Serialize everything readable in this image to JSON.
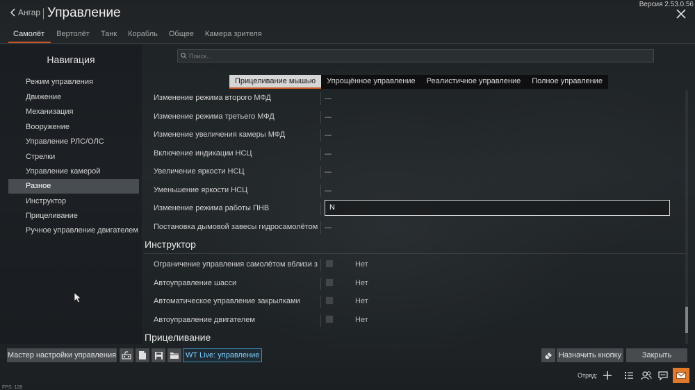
{
  "header": {
    "back_label": "Ангар",
    "title": "Управление",
    "version": "Версия 2.53.0.56"
  },
  "vehicle_tabs": [
    "Самолёт",
    "Вертолёт",
    "Танк",
    "Корабль",
    "Общее",
    "Камера зрителя"
  ],
  "nav": {
    "title": "Навигация",
    "items": [
      "Режим управления",
      "Движение",
      "Механизация",
      "Вооружение",
      "Управление РЛС/ОЛС",
      "Стрелки",
      "Управление камерой",
      "Разное",
      "Инструктор",
      "Прицеливание",
      "Ручное управление двигателем"
    ],
    "active_index": 7
  },
  "search": {
    "placeholder": "Поиск..."
  },
  "mode_tabs": [
    "Прицеливание мышью",
    "Упрощённое управление",
    "Реалистичное управление",
    "Полное управление"
  ],
  "bindings": [
    {
      "label": "Изменение режима второго МФД",
      "value": "---"
    },
    {
      "label": "Изменение режима третьего МФД",
      "value": "---"
    },
    {
      "label": "Изменение увеличения камеры МФД",
      "value": "---"
    },
    {
      "label": "Включение индикации НСЦ",
      "value": "---"
    },
    {
      "label": "Увеличение яркости НСЦ",
      "value": "---"
    },
    {
      "label": "Уменьшение яркости НСЦ",
      "value": "---"
    },
    {
      "label": "Изменение режима работы ПНВ",
      "value": "N"
    },
    {
      "label": "Постановка дымовой завесы гидросамолётом",
      "value": "---"
    }
  ],
  "instructor_section": {
    "title": "Инструктор",
    "items": [
      {
        "label": "Ограничение управления самолётом вблизи з",
        "value": "Нет"
      },
      {
        "label": "Автоуправление шасси",
        "value": "Нет"
      },
      {
        "label": "Автоматическое управление закрылками",
        "value": "Нет"
      },
      {
        "label": "Автоуправление двигателем",
        "value": "Нет"
      }
    ]
  },
  "aiming_section": {
    "title": "Прицеливание"
  },
  "bottom_bar": {
    "wizard_label": "Мастер настройки управления",
    "wt_live_label": "WT Live: управление",
    "assign_label": "Назначить кнопку",
    "close_label": "Закрыть"
  },
  "footer": {
    "fps_label": "FPS: 128",
    "squad_label": "Отряд:"
  },
  "colors": {
    "accent": "#c85a2a",
    "link": "#7fd0ff",
    "mail": "#e07a2a"
  }
}
